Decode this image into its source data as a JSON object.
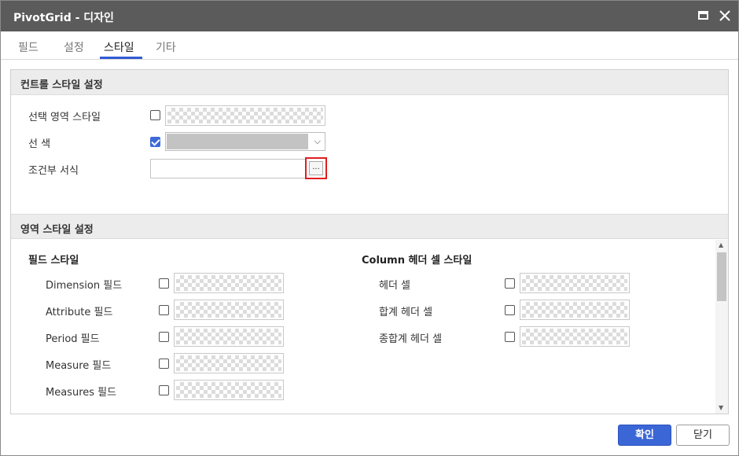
{
  "window": {
    "title": "PivotGrid - 디자인"
  },
  "tabs": [
    {
      "label": "필드"
    },
    {
      "label": "설정"
    },
    {
      "label": "스타일"
    },
    {
      "label": "기타"
    }
  ],
  "active_tab": "스타일",
  "control_section": {
    "title": "컨트롤 스타일 설정",
    "rows": {
      "selection_style": {
        "label": "선택 영역 스타일",
        "checked": false
      },
      "line_color": {
        "label": "선 색",
        "checked": true,
        "color": "#c3c3c3"
      },
      "conditional_format": {
        "label": "조건부 서식",
        "value": "",
        "button": "..."
      }
    }
  },
  "area_section": {
    "title": "영역 스타일 설정",
    "field_style": {
      "title": "필드 스타일",
      "items": [
        {
          "label": "Dimension 필드",
          "checked": false
        },
        {
          "label": "Attribute 필드",
          "checked": false
        },
        {
          "label": "Period 필드",
          "checked": false
        },
        {
          "label": "Measure 필드",
          "checked": false
        },
        {
          "label": "Measures 필드",
          "checked": false
        }
      ]
    },
    "column_header_style": {
      "title": "Column 헤더 셀 스타일",
      "items": [
        {
          "label": "헤더 셀",
          "checked": false
        },
        {
          "label": "합계 헤더 셀",
          "checked": false
        },
        {
          "label": "종합계 헤더 셀",
          "checked": false
        }
      ]
    }
  },
  "footer": {
    "ok_label": "확인",
    "close_label": "닫기"
  },
  "colors": {
    "titlebar": "#5b5b5b",
    "accent": "#3b67d6",
    "highlight": "#e11d1d"
  }
}
